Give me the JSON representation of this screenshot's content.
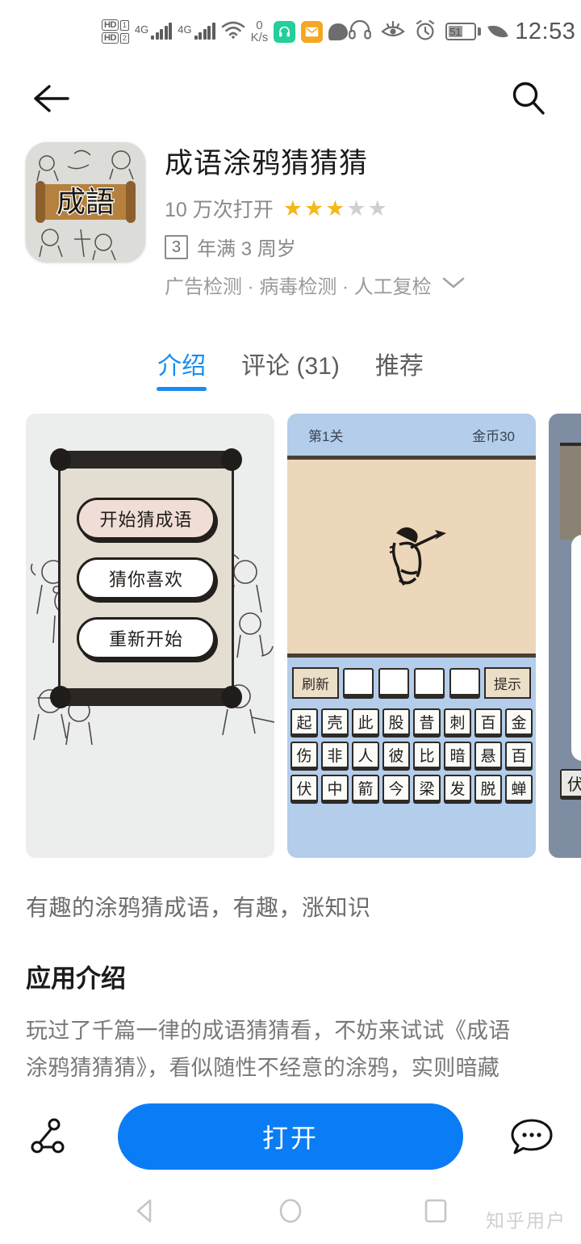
{
  "statusbar": {
    "hd1_label": "HD",
    "hd1_num": "1",
    "hd2_label": "HD",
    "hd2_num": "2",
    "net1": "4G",
    "net2": "4G",
    "datarate_value": "0",
    "datarate_unit": "K/s",
    "icons": [
      "headset-icon",
      "eye-comfort-icon",
      "alarm-icon"
    ],
    "battery_percent": "51",
    "time": "12:53"
  },
  "topnav": {
    "back_label": "back-arrow",
    "search_label": "search"
  },
  "app": {
    "icon_text": "成語",
    "title": "成语涂鸦猜猜猜",
    "opens": "10 万次打开",
    "rating_filled": 3,
    "rating_total": 5,
    "age_badge": "3",
    "age_text": "年满 3 周岁",
    "checks": "广告检测 · 病毒检测 · 人工复检"
  },
  "tabs": [
    {
      "label": "介绍",
      "active": true
    },
    {
      "label": "评论 (31)",
      "active": false
    },
    {
      "label": "推荐",
      "active": false
    }
  ],
  "screenshots": {
    "shot1": {
      "buttons": [
        "开始猜成语",
        "猜你喜欢",
        "重新开始"
      ]
    },
    "shot2": {
      "level": "第1关",
      "coins": "金币30",
      "refresh": "刷新",
      "hint": "提示",
      "answer_slots": 4,
      "grid_rows": [
        [
          "起",
          "壳",
          "此",
          "股",
          "昔",
          "刺",
          "百",
          "金"
        ],
        [
          "伤",
          "非",
          "人",
          "彼",
          "比",
          "暗",
          "悬",
          "百"
        ],
        [
          "伏",
          "中",
          "箭",
          "今",
          "梁",
          "发",
          "脱",
          "蝉"
        ]
      ]
    },
    "shot3": {
      "cell": "伏"
    }
  },
  "content": {
    "tagline": "有趣的涂鸦猜成语，有趣，涨知识",
    "section_title": "应用介绍",
    "description": "玩过了千篇一律的成语猜猜看，不妨来试试《成语涂鸦猜猜猜》，看似随性不经意的涂鸦，实则暗藏典故，参透其意，会心一笑，也是妙事一件。…"
  },
  "bottombar": {
    "share_label": "share",
    "open_label": "打开",
    "comment_label": "comment"
  },
  "navbar": {
    "back": "nav-back",
    "home": "nav-home",
    "recents": "nav-recents"
  },
  "watermark": "知乎用户",
  "colors": {
    "accent_blue": "#0a7cf5",
    "tab_blue": "#1a8cf0",
    "star_gold": "#f5b81c",
    "shot2_bg": "#b3cdea"
  }
}
